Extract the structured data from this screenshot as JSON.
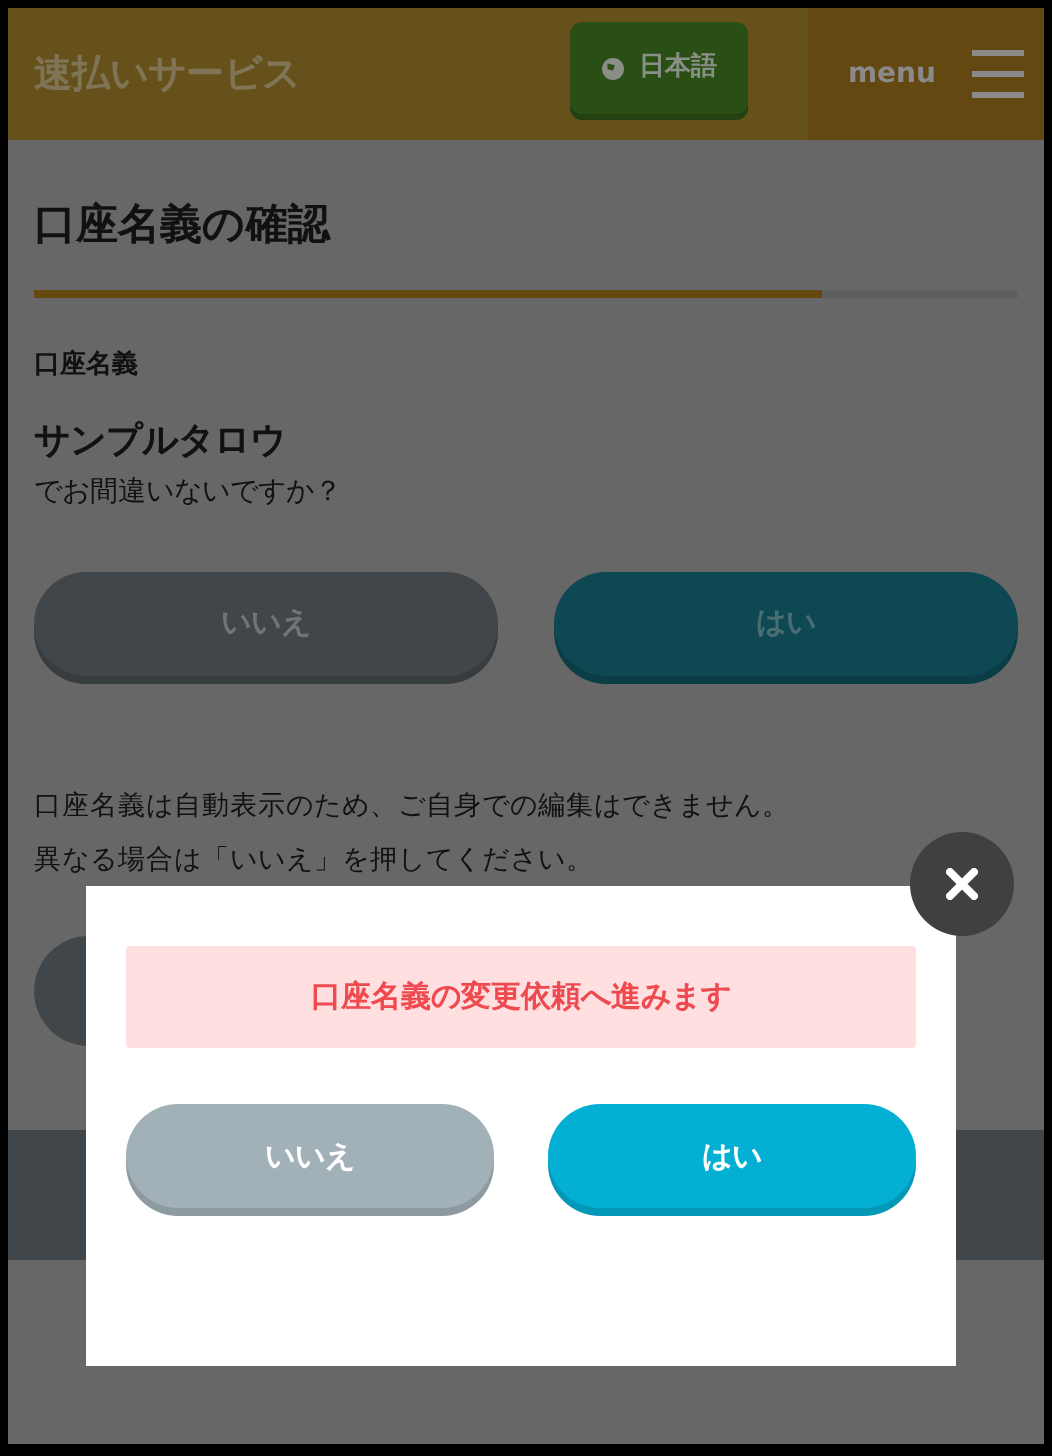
{
  "header": {
    "title": "速払いサービス",
    "language_button": "日本語",
    "menu_label": "menu"
  },
  "page": {
    "title": "口座名義の確認",
    "progress": {
      "level": 0.8
    },
    "field_label": "口座名義",
    "account_name": "サンプルタロウ",
    "question": "でお間違いないですか？",
    "buttons": [
      {
        "label": "いいえ",
        "kind": "secondary"
      },
      {
        "label": "はい",
        "kind": "primary"
      }
    ],
    "notes": [
      "口座名義は自動表示のため、ご自身での編集はできません。",
      "異なる場合は「いいえ」を押してください。"
    ]
  },
  "modal": {
    "message": "口座名義の変更依頼へ進みます",
    "buttons": [
      {
        "label": "いいえ",
        "kind": "secondary"
      },
      {
        "label": "はい",
        "kind": "primary"
      }
    ]
  }
}
